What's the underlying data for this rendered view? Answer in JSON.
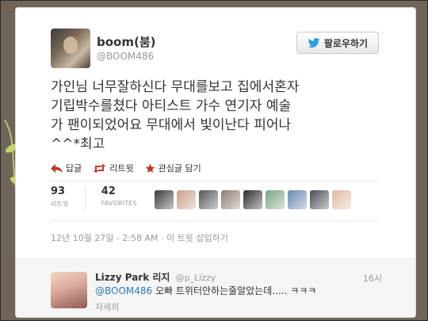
{
  "header": {
    "full_name": "boom(붐)",
    "screen_name": "@BOOM486",
    "follow_label": "팔로우하기",
    "follow_icon": "twitter-bird-icon"
  },
  "tweet": {
    "text": "가인님 너무잘하신다 무대를보고 집에서혼자\n기립박수를쳤다 아티스트 가수 연기자 예술\n가 팬이되었어요 무대에서 빛이난다 피어나\n^^*최고"
  },
  "actions": {
    "reply_label": "답글",
    "retweet_label": "리트윗",
    "favorite_label": "관심글 담기",
    "reply_icon": "reply-arrow-icon",
    "retweet_icon": "retweet-icon",
    "favorite_icon": "star-icon"
  },
  "stats": {
    "retweets_count": "93",
    "retweets_label": "리트윗",
    "favorites_count": "42",
    "favorites_label": "FAVORITES"
  },
  "favoriters": [
    {
      "color": "#3a3a3a"
    },
    {
      "color": "#c79f8a"
    },
    {
      "color": "#555555"
    },
    {
      "color": "#8f7d70"
    },
    {
      "color": "#2e2a2a"
    },
    {
      "color": "#7ca37d"
    },
    {
      "color": "#6a87b0"
    },
    {
      "color": "#4a4a52"
    },
    {
      "color": "#e0b9a3"
    }
  ],
  "timestamp": "12년 10월 27일 - 2:58 AM · 이 트윗 삽입하기",
  "reply": {
    "name": "Lizzy Park 리지",
    "handle": "@p_Lizzy",
    "time": "16시",
    "mention": "@BOOM486",
    "text": " 오빠 트위터안하는줄알았는데..... ㅋㅋㅋ",
    "expand_label": "자세히"
  },
  "colors": {
    "link": "#2b7bb9",
    "action_icon": "#c0392b",
    "background": "#6e6558"
  }
}
